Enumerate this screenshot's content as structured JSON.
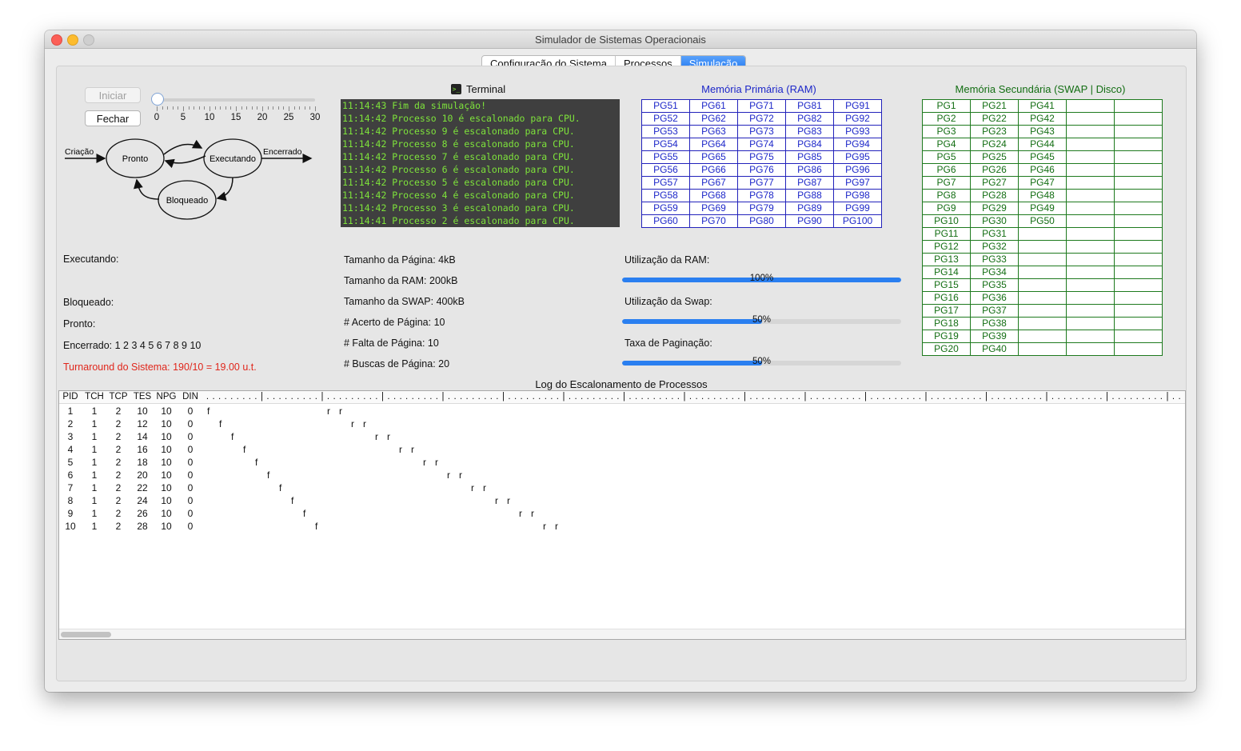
{
  "window": {
    "title": "Simulador de Sistemas Operacionais"
  },
  "tabs": [
    {
      "label": "Configuração do Sistema",
      "active": false
    },
    {
      "label": "Processos",
      "active": false
    },
    {
      "label": "Simulação",
      "active": true
    }
  ],
  "controls": {
    "start_label": "Iniciar",
    "close_label": "Fechar",
    "slider_labels": [
      "0",
      "5",
      "10",
      "15",
      "20",
      "25",
      "30"
    ],
    "slider_value": 0
  },
  "state_diagram": {
    "states": [
      "Pronto",
      "Executando",
      "Bloqueado"
    ],
    "in_label": "Criação",
    "out_label": "Encerrado"
  },
  "terminal": {
    "title": "Terminal",
    "lines": [
      "11:14:43  Fim da simulação!",
      "11:14:42  Processo 10 é escalonado para CPU.",
      "11:14:42  Processo 9 é escalonado para CPU.",
      "11:14:42  Processo 8 é escalonado para CPU.",
      "11:14:42  Processo 7 é escalonado para CPU.",
      "11:14:42  Processo 6 é escalonado para CPU.",
      "11:14:42  Processo 5 é escalonado para CPU.",
      "11:14:42  Processo 4 é escalonado para CPU.",
      "11:14:42  Processo 3 é escalonado para CPU.",
      "11:14:41  Processo 2 é escalonado para CPU."
    ]
  },
  "ram": {
    "title": "Memória Primária (RAM)",
    "rows": [
      [
        "PG51",
        "PG61",
        "PG71",
        "PG81",
        "PG91"
      ],
      [
        "PG52",
        "PG62",
        "PG72",
        "PG82",
        "PG92"
      ],
      [
        "PG53",
        "PG63",
        "PG73",
        "PG83",
        "PG93"
      ],
      [
        "PG54",
        "PG64",
        "PG74",
        "PG84",
        "PG94"
      ],
      [
        "PG55",
        "PG65",
        "PG75",
        "PG85",
        "PG95"
      ],
      [
        "PG56",
        "PG66",
        "PG76",
        "PG86",
        "PG96"
      ],
      [
        "PG57",
        "PG67",
        "PG77",
        "PG87",
        "PG97"
      ],
      [
        "PG58",
        "PG68",
        "PG78",
        "PG88",
        "PG98"
      ],
      [
        "PG59",
        "PG69",
        "PG79",
        "PG89",
        "PG99"
      ],
      [
        "PG60",
        "PG70",
        "PG80",
        "PG90",
        "PG100"
      ]
    ]
  },
  "swap": {
    "title": "Memória Secundária (SWAP | Disco)",
    "rows": [
      [
        "PG1",
        "PG21",
        "PG41",
        "",
        ""
      ],
      [
        "PG2",
        "PG22",
        "PG42",
        "",
        ""
      ],
      [
        "PG3",
        "PG23",
        "PG43",
        "",
        ""
      ],
      [
        "PG4",
        "PG24",
        "PG44",
        "",
        ""
      ],
      [
        "PG5",
        "PG25",
        "PG45",
        "",
        ""
      ],
      [
        "PG6",
        "PG26",
        "PG46",
        "",
        ""
      ],
      [
        "PG7",
        "PG27",
        "PG47",
        "",
        ""
      ],
      [
        "PG8",
        "PG28",
        "PG48",
        "",
        ""
      ],
      [
        "PG9",
        "PG29",
        "PG49",
        "",
        ""
      ],
      [
        "PG10",
        "PG30",
        "PG50",
        "",
        ""
      ],
      [
        "PG11",
        "PG31",
        "",
        "",
        ""
      ],
      [
        "PG12",
        "PG32",
        "",
        "",
        ""
      ],
      [
        "PG13",
        "PG33",
        "",
        "",
        ""
      ],
      [
        "PG14",
        "PG34",
        "",
        "",
        ""
      ],
      [
        "PG15",
        "PG35",
        "",
        "",
        ""
      ],
      [
        "PG16",
        "PG36",
        "",
        "",
        ""
      ],
      [
        "PG17",
        "PG37",
        "",
        "",
        ""
      ],
      [
        "PG18",
        "PG38",
        "",
        "",
        ""
      ],
      [
        "PG19",
        "PG39",
        "",
        "",
        ""
      ],
      [
        "PG20",
        "PG40",
        "",
        "",
        ""
      ]
    ]
  },
  "status": {
    "executing": "Executando:",
    "blocked": "Bloqueado:",
    "ready": "Pronto:",
    "finished": "Encerrado: 1 2 3 4 5 6 7 8 9 10",
    "turnaround": "Turnaround do Sistema: 190/10 = 19.00 u.t.",
    "turnaround_color": "#e0261b"
  },
  "memory_stats": {
    "page_size": "Tamanho da Página: 4kB",
    "ram_size": "Tamanho da RAM: 200kB",
    "swap_size": "Tamanho da SWAP: 400kB",
    "page_hits": "# Acerto de Página: 10",
    "page_faults": "# Falta de Página: 10",
    "page_fetches": "# Buscas de Página: 20"
  },
  "usage": {
    "ram_label": "Utilização da RAM:",
    "ram_value": 100,
    "ram_text": "100%",
    "swap_label": "Utilização da Swap:",
    "swap_value": 50,
    "swap_text": "50%",
    "paging_label": "Taxa de Paginação:",
    "paging_value": 50,
    "paging_text": "50%"
  },
  "log": {
    "title": "Log do Escalonamento de Processos",
    "columns": [
      "PID",
      "TCH",
      "TCP",
      "TES",
      "NPG",
      "DIN"
    ],
    "rows": [
      {
        "cells": [
          "1",
          "1",
          "2",
          "10",
          "10",
          "0"
        ],
        "f": 0,
        "r": [
          10,
          11
        ]
      },
      {
        "cells": [
          "2",
          "1",
          "2",
          "12",
          "10",
          "0"
        ],
        "f": 1,
        "r": [
          12,
          13
        ]
      },
      {
        "cells": [
          "3",
          "1",
          "2",
          "14",
          "10",
          "0"
        ],
        "f": 2,
        "r": [
          14,
          15
        ]
      },
      {
        "cells": [
          "4",
          "1",
          "2",
          "16",
          "10",
          "0"
        ],
        "f": 3,
        "r": [
          16,
          17
        ]
      },
      {
        "cells": [
          "5",
          "1",
          "2",
          "18",
          "10",
          "0"
        ],
        "f": 4,
        "r": [
          18,
          19
        ]
      },
      {
        "cells": [
          "6",
          "1",
          "2",
          "20",
          "10",
          "0"
        ],
        "f": 5,
        "r": [
          20,
          21
        ]
      },
      {
        "cells": [
          "7",
          "1",
          "2",
          "22",
          "10",
          "0"
        ],
        "f": 6,
        "r": [
          22,
          23
        ]
      },
      {
        "cells": [
          "8",
          "1",
          "2",
          "24",
          "10",
          "0"
        ],
        "f": 7,
        "r": [
          24,
          25
        ]
      },
      {
        "cells": [
          "9",
          "1",
          "2",
          "26",
          "10",
          "0"
        ],
        "f": 8,
        "r": [
          26,
          27
        ]
      },
      {
        "cells": [
          "10",
          "1",
          "2",
          "28",
          "10",
          "0"
        ],
        "f": 9,
        "r": [
          28,
          29
        ]
      }
    ]
  }
}
